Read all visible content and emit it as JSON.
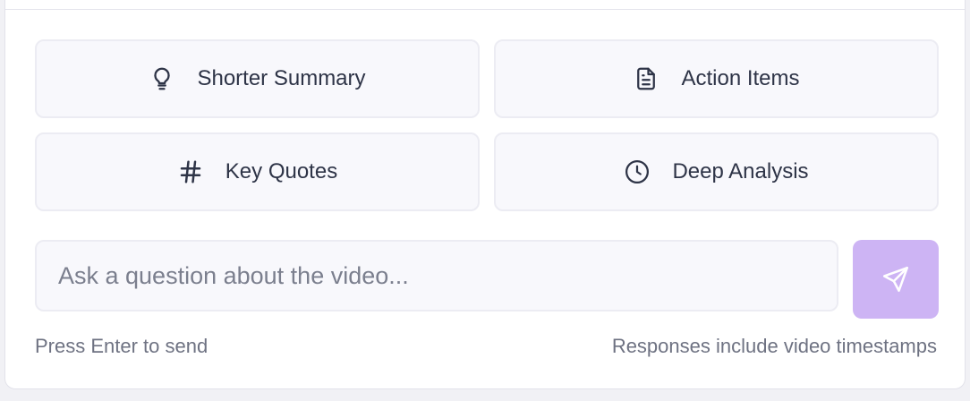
{
  "quick_actions": [
    {
      "label": "Shorter Summary",
      "icon": "lightbulb-icon"
    },
    {
      "label": "Action Items",
      "icon": "document-icon"
    },
    {
      "label": "Key Quotes",
      "icon": "hash-icon"
    },
    {
      "label": "Deep Analysis",
      "icon": "clock-icon"
    }
  ],
  "chat_input": {
    "placeholder": "Ask a question about the video..."
  },
  "send_button": {
    "icon": "send-icon",
    "color": "#cdb4f4"
  },
  "footer": {
    "hint_left": "Press Enter to send",
    "hint_right": "Responses include video timestamps"
  }
}
